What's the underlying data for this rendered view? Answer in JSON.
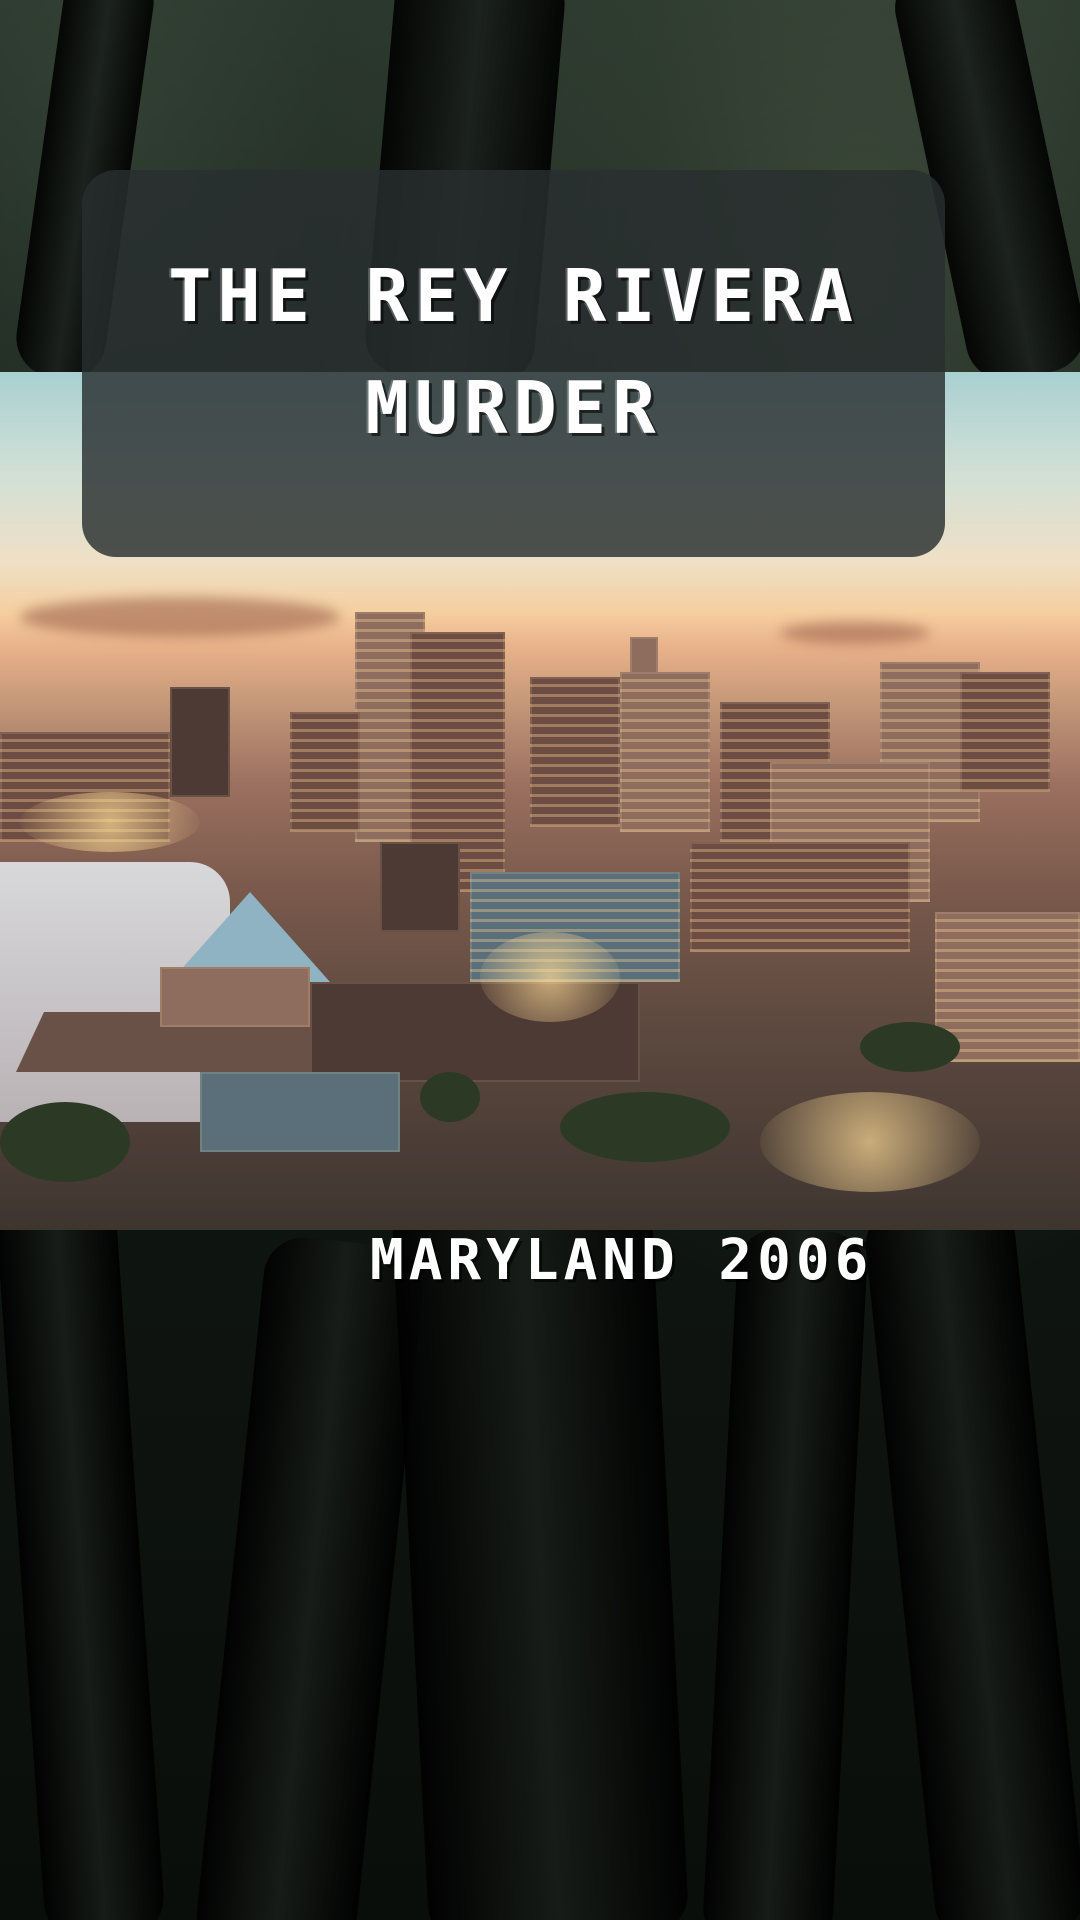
{
  "title": {
    "line1": "THE REY RIVERA",
    "line2": "MURDER"
  },
  "caption": "MARYLAND 2006",
  "colors": {
    "panel": "#282e30",
    "text": "#ffffff",
    "forest": "#121a15"
  }
}
